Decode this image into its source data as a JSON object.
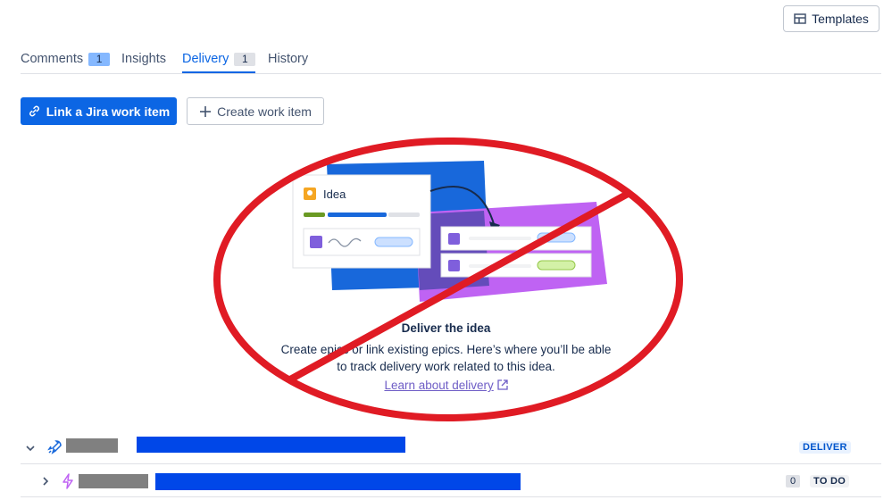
{
  "header": {
    "templates_label": "Templates"
  },
  "tabs": [
    {
      "label": "Comments",
      "count": "1"
    },
    {
      "label": "Insights"
    },
    {
      "label": "Delivery",
      "count": "1",
      "active": true
    },
    {
      "label": "History"
    }
  ],
  "actions": {
    "link_jira_label": "Link a Jira work item",
    "create_work_item_label": "Create work item"
  },
  "empty_state": {
    "illustration_idea_label": "Idea",
    "title": "Deliver the idea",
    "description_line1": "Create epics or link existing epics. Here’s where you’ll be able",
    "description_line2": "to track delivery work related to this idea.",
    "learn_link": "Learn about delivery"
  },
  "rows": [
    {
      "status": "DELIVER"
    },
    {
      "count": "0",
      "status": "TO DO"
    }
  ],
  "colors": {
    "primary": "#0c66e4",
    "link": "#6e5dc6",
    "annotation_red": "#e01b24"
  }
}
